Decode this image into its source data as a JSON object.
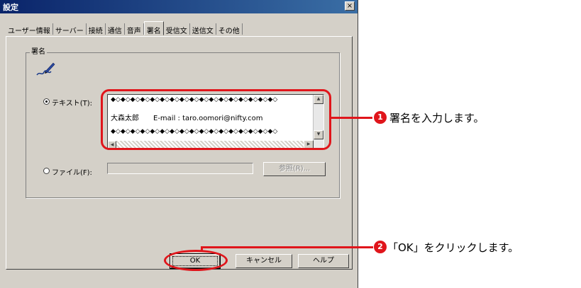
{
  "dialog": {
    "title": "設定",
    "close_glyph": "×"
  },
  "tabs": [
    {
      "label": "ユーザー情報",
      "active": false
    },
    {
      "label": "サーバー",
      "active": false
    },
    {
      "label": "接続",
      "active": false
    },
    {
      "label": "通信",
      "active": false
    },
    {
      "label": "音声",
      "active": false
    },
    {
      "label": "署名",
      "active": true
    },
    {
      "label": "受信文",
      "active": false
    },
    {
      "label": "送信文",
      "active": false
    },
    {
      "label": "その他",
      "active": false
    }
  ],
  "signature_group": {
    "label": "署名",
    "icon": "pen-signature-icon",
    "text_option": {
      "label": "テキスト(T):",
      "selected": true
    },
    "text_lines": [
      "◆◇◆◇◆◇◆◇◆◇◆◇◆◇◆◇◆◇◆◇◆◇◆◇◆◇◆◇◆◇◆◇◆◇",
      "大森太郎　　E-mail : taro.oomori@nifty.com",
      "◆◇◆◇◆◇◆◇◆◇◆◇◆◇◆◇◆◇◆◇◆◇◆◇◆◇◆◇◆◇◆◇◆◇"
    ],
    "file_option": {
      "label": "ファイル(F):",
      "selected": false,
      "value": ""
    },
    "browse_label": "参照(R)..."
  },
  "buttons": {
    "ok": "OK",
    "cancel": "キャンセル",
    "help": "ヘルプ"
  },
  "annotations": {
    "step1_number": "1",
    "step1_text": "署名を入力します。",
    "step2_number": "2",
    "step2_text": "「OK」をクリックします。"
  },
  "colors": {
    "accent_red": "#e0151b",
    "dialog_gray": "#d4d0c8",
    "titlebar": "#0a246a"
  }
}
